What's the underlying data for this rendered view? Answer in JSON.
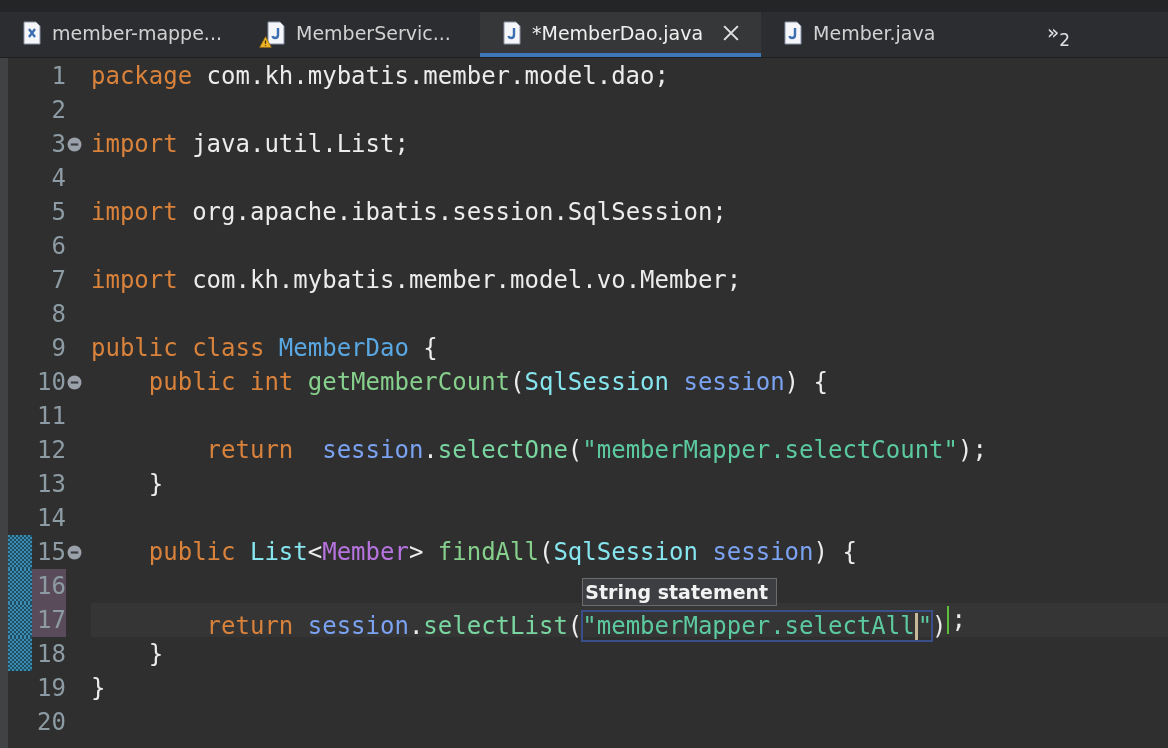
{
  "tabs": [
    {
      "label": "member-mappe...",
      "kind": "xml",
      "warning": false,
      "selected": false,
      "closable": false
    },
    {
      "label": "MemberServic...",
      "kind": "java",
      "warning": true,
      "selected": false,
      "closable": false
    },
    {
      "label": "*MemberDao.java",
      "kind": "java",
      "warning": false,
      "selected": true,
      "closable": true
    },
    {
      "label": "Member.java",
      "kind": "java",
      "warning": false,
      "selected": false,
      "closable": false
    }
  ],
  "overflow": {
    "glyph": "»",
    "count": "2"
  },
  "editor": {
    "lines": [
      {
        "number": "1",
        "fold": false,
        "diff": false,
        "changed": false,
        "current": false,
        "tokens": [
          {
            "kind": "keyword",
            "text": "package "
          },
          {
            "kind": "plain",
            "text": "com.kh.mybatis.member.model.dao;"
          }
        ]
      },
      {
        "number": "2",
        "fold": false,
        "diff": false,
        "changed": false,
        "current": false
      },
      {
        "number": "3",
        "fold": true,
        "diff": false,
        "changed": false,
        "current": false,
        "tokens": [
          {
            "kind": "keyword",
            "text": "import "
          },
          {
            "kind": "plain",
            "text": "java.util.List;"
          }
        ]
      },
      {
        "number": "4",
        "fold": false,
        "diff": false,
        "changed": false,
        "current": false
      },
      {
        "number": "5",
        "fold": false,
        "diff": false,
        "changed": false,
        "current": false,
        "tokens": [
          {
            "kind": "keyword",
            "text": "import "
          },
          {
            "kind": "plain",
            "text": "org.apache.ibatis.session.SqlSession;"
          }
        ]
      },
      {
        "number": "6",
        "fold": false,
        "diff": false,
        "changed": false,
        "current": false
      },
      {
        "number": "7",
        "fold": false,
        "diff": false,
        "changed": false,
        "current": false,
        "tokens": [
          {
            "kind": "keyword",
            "text": "import "
          },
          {
            "kind": "plain",
            "text": "com.kh.mybatis.member.model.vo.Member;"
          }
        ]
      },
      {
        "number": "8",
        "fold": false,
        "diff": false,
        "changed": false,
        "current": false
      },
      {
        "number": "9",
        "fold": false,
        "diff": false,
        "changed": false,
        "current": false,
        "tokens": [
          {
            "kind": "keyword",
            "text": "public class "
          },
          {
            "kind": "class",
            "text": "MemberDao"
          },
          {
            "kind": "plain",
            "text": " {"
          }
        ]
      },
      {
        "number": "10",
        "fold": true,
        "diff": false,
        "changed": false,
        "current": false,
        "tokens": [
          {
            "kind": "keyword",
            "text": "    public int "
          },
          {
            "kind": "method",
            "text": "getMemberCount"
          },
          {
            "kind": "plain",
            "text": "("
          },
          {
            "kind": "type",
            "text": "SqlSession "
          },
          {
            "kind": "variable",
            "text": "session"
          },
          {
            "kind": "plain",
            "text": ") {"
          }
        ]
      },
      {
        "number": "11",
        "fold": false,
        "diff": false,
        "changed": false,
        "current": false
      },
      {
        "number": "12",
        "fold": false,
        "diff": false,
        "changed": false,
        "current": false,
        "tokens": [
          {
            "kind": "keyword",
            "text": "        return  "
          },
          {
            "kind": "variable",
            "text": "session"
          },
          {
            "kind": "plain",
            "text": "."
          },
          {
            "kind": "call",
            "text": "selectOne"
          },
          {
            "kind": "plain",
            "text": "("
          },
          {
            "kind": "string",
            "text": "\"memberMapper.selectCount\""
          },
          {
            "kind": "plain",
            "text": ");"
          }
        ]
      },
      {
        "number": "13",
        "fold": false,
        "diff": false,
        "changed": false,
        "current": false,
        "tokens": [
          {
            "kind": "plain",
            "text": "    }"
          }
        ]
      },
      {
        "number": "14",
        "fold": false,
        "diff": false,
        "changed": false,
        "current": false
      },
      {
        "number": "15",
        "fold": true,
        "diff": true,
        "changed": false,
        "current": false,
        "tokens": [
          {
            "kind": "keyword",
            "text": "    public "
          },
          {
            "kind": "type",
            "text": "List"
          },
          {
            "kind": "plain",
            "text": "<"
          },
          {
            "kind": "typeparam",
            "text": "Member"
          },
          {
            "kind": "plain",
            "text": "> "
          },
          {
            "kind": "method",
            "text": "findAll"
          },
          {
            "kind": "plain",
            "text": "("
          },
          {
            "kind": "type",
            "text": "SqlSession "
          },
          {
            "kind": "variable",
            "text": "session"
          },
          {
            "kind": "plain",
            "text": ") {"
          }
        ]
      },
      {
        "number": "16",
        "fold": false,
        "diff": true,
        "changed": true,
        "current": false
      },
      {
        "number": "17",
        "fold": false,
        "diff": true,
        "changed": true,
        "current": true,
        "tokens": [
          {
            "kind": "keyword",
            "text": "        return "
          },
          {
            "kind": "variable",
            "text": "session"
          },
          {
            "kind": "plain",
            "text": "."
          },
          {
            "kind": "call",
            "text": "selectList"
          },
          {
            "kind": "plain",
            "text": "("
          },
          {
            "kind": "linked",
            "text": "\"memberMapper.selectAll",
            "after_caret": "\"",
            "hint": "String statement"
          },
          {
            "kind": "plain",
            "text": ")"
          },
          {
            "kind": "exit",
            "text": ";"
          }
        ]
      },
      {
        "number": "18",
        "fold": false,
        "diff": true,
        "changed": false,
        "current": false,
        "tokens": [
          {
            "kind": "plain",
            "text": "    }"
          }
        ]
      },
      {
        "number": "19",
        "fold": false,
        "diff": false,
        "changed": false,
        "current": false,
        "tokens": [
          {
            "kind": "plain",
            "text": "}"
          }
        ]
      },
      {
        "number": "20",
        "fold": false,
        "diff": false,
        "changed": false,
        "current": false
      }
    ]
  }
}
